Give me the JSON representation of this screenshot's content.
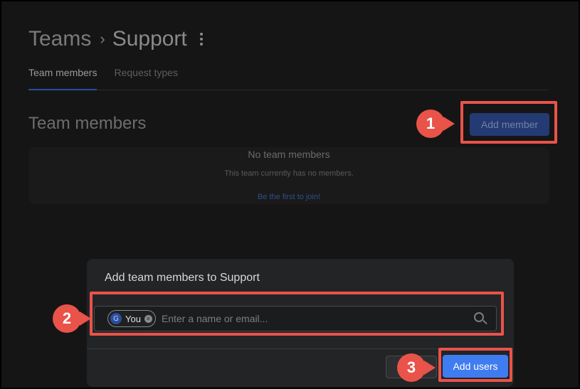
{
  "breadcrumb": {
    "parent": "Teams",
    "separator": "›",
    "current": "Support"
  },
  "tabs": [
    {
      "label": "Team members",
      "active": true
    },
    {
      "label": "Request types",
      "active": false
    }
  ],
  "section": {
    "title": "Team members",
    "add_button": "Add member"
  },
  "empty_state": {
    "title": "No team members",
    "description": "This team currently has no members.",
    "link": "Be the first to join!"
  },
  "modal": {
    "title": "Add team members to Support",
    "chip": {
      "avatar_letter": "G",
      "label": "You"
    },
    "input_placeholder": "Enter a name or email...",
    "submit_label": "Add users"
  },
  "callouts": [
    "1",
    "2",
    "3"
  ],
  "colors": {
    "callout": "#e9534a",
    "primary": "#3f7cf0"
  }
}
